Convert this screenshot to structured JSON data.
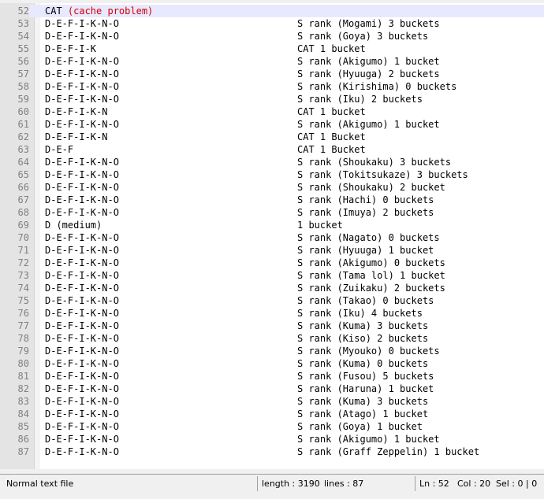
{
  "editor": {
    "current_line": "52",
    "lines": [
      {
        "n": "52",
        "code": "CAT ",
        "code_red": "(cache problem)",
        "comment": ""
      },
      {
        "n": "53",
        "code": "D-E-F-I-K-N-O",
        "comment": "S rank (Mogami) 3 buckets"
      },
      {
        "n": "54",
        "code": "D-E-F-I-K-N-O",
        "comment": "S rank (Goya) 3 buckets"
      },
      {
        "n": "55",
        "code": "D-E-F-I-K",
        "comment": "CAT 1 bucket"
      },
      {
        "n": "56",
        "code": "D-E-F-I-K-N-O",
        "comment": "S rank (Akigumo) 1 bucket"
      },
      {
        "n": "57",
        "code": "D-E-F-I-K-N-O",
        "comment": "S rank (Hyuuga) 2 buckets"
      },
      {
        "n": "58",
        "code": "D-E-F-I-K-N-O",
        "comment": "S rank (Kirishima) 0 buckets"
      },
      {
        "n": "59",
        "code": "D-E-F-I-K-N-O",
        "comment": "S rank (Iku) 2 buckets"
      },
      {
        "n": "60",
        "code": "D-E-F-I-K-N",
        "comment": "CAT 1 bucket"
      },
      {
        "n": "61",
        "code": "D-E-F-I-K-N-O",
        "comment": "S rank (Akigumo) 1 bucket"
      },
      {
        "n": "62",
        "code": "D-E-F-I-K-N",
        "comment": "CAT 1 Bucket"
      },
      {
        "n": "63",
        "code": "D-E-F",
        "comment": "CAT 1 Bucket"
      },
      {
        "n": "64",
        "code": "D-E-F-I-K-N-O",
        "comment": "S rank (Shoukaku) 3 buckets"
      },
      {
        "n": "65",
        "code": "D-E-F-I-K-N-O",
        "comment": "S rank (Tokitsukaze) 3 buckets"
      },
      {
        "n": "66",
        "code": "D-E-F-I-K-N-O",
        "comment": "S rank (Shoukaku) 2 bucket"
      },
      {
        "n": "67",
        "code": "D-E-F-I-K-N-O",
        "comment": "S rank (Hachi) 0 buckets"
      },
      {
        "n": "68",
        "code": "D-E-F-I-K-N-O",
        "comment": "S rank (Imuya) 2 buckets"
      },
      {
        "n": "69",
        "code": "D (medium)",
        "comment": "1 bucket"
      },
      {
        "n": "70",
        "code": "D-E-F-I-K-N-O",
        "comment": "S rank (Nagato) 0 buckets"
      },
      {
        "n": "71",
        "code": "D-E-F-I-K-N-O",
        "comment": "S rank (Hyuuga) 1 bucket"
      },
      {
        "n": "72",
        "code": "D-E-F-I-K-N-O",
        "comment": "S rank (Akigumo) 0 buckets"
      },
      {
        "n": "73",
        "code": "D-E-F-I-K-N-O",
        "comment": "S rank (Tama lol) 1 bucket"
      },
      {
        "n": "74",
        "code": "D-E-F-I-K-N-O",
        "comment": "S rank (Zuikaku) 2 buckets"
      },
      {
        "n": "75",
        "code": "D-E-F-I-K-N-O",
        "comment": "S rank (Takao) 0 buckets"
      },
      {
        "n": "76",
        "code": "D-E-F-I-K-N-O",
        "comment": "S rank (Iku) 4 buckets"
      },
      {
        "n": "77",
        "code": "D-E-F-I-K-N-O",
        "comment": "S rank (Kuma) 3 buckets"
      },
      {
        "n": "78",
        "code": "D-E-F-I-K-N-O",
        "comment": "S rank (Kiso) 2 buckets"
      },
      {
        "n": "79",
        "code": "D-E-F-I-K-N-O",
        "comment": "S rank (Myouko) 0 buckets"
      },
      {
        "n": "80",
        "code": "D-E-F-I-K-N-O",
        "comment": "S rank (Kuma) 0 buckets"
      },
      {
        "n": "81",
        "code": "D-E-F-I-K-N-O",
        "comment": "S rank (Fusou) 5 buckets"
      },
      {
        "n": "82",
        "code": "D-E-F-I-K-N-O",
        "comment": "S rank (Haruna) 1 bucket"
      },
      {
        "n": "83",
        "code": "D-E-F-I-K-N-O",
        "comment": "S rank (Kuma) 3 buckets"
      },
      {
        "n": "84",
        "code": "D-E-F-I-K-N-O",
        "comment": "S rank (Atago) 1 bucket"
      },
      {
        "n": "85",
        "code": "D-E-F-I-K-N-O",
        "comment": "S rank (Goya) 1 bucket"
      },
      {
        "n": "86",
        "code": "D-E-F-I-K-N-O",
        "comment": "S rank (Akigumo) 1 bucket"
      },
      {
        "n": "87",
        "code": "D-E-F-I-K-N-O",
        "comment": "S rank (Graff Zeppelin) 1 bucket"
      }
    ]
  },
  "statusbar": {
    "file_type": "Normal text file",
    "length": "length : 3190",
    "lines": "lines : 87",
    "ln": "Ln : 52",
    "col": "Col : 20",
    "sel": "Sel : 0 | 0"
  },
  "colors": {
    "current_line_bg": "#e8e8ff",
    "gutter_bg": "#e4e4e4",
    "line_number": "#808080",
    "highlight_red": "#d00000"
  }
}
